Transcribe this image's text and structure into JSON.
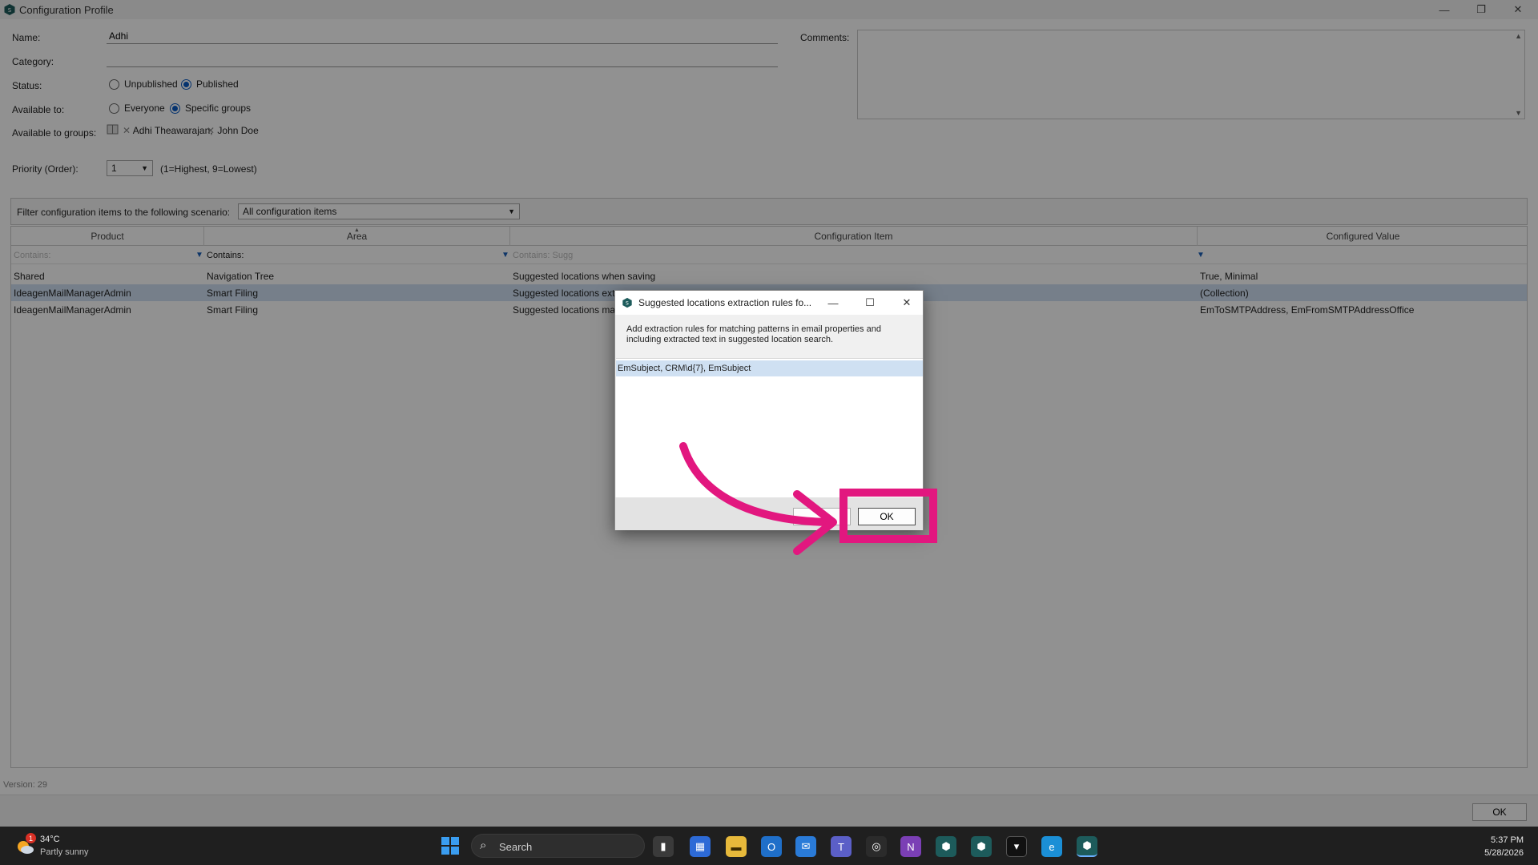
{
  "window": {
    "title": "Configuration Profile",
    "minimize": "—",
    "restore": "❐",
    "close": "✕"
  },
  "form": {
    "name_label": "Name:",
    "name_value": "Adhi",
    "category_label": "Category:",
    "category_value": "",
    "status_label": "Status:",
    "status_options": [
      "Unpublished",
      "Published"
    ],
    "status_selected": "Published",
    "available_label": "Available to:",
    "available_options": [
      "Everyone",
      "Specific groups"
    ],
    "available_selected": "Specific groups",
    "groups_label": "Available to groups:",
    "groups": [
      "Adhi Theawarajan,",
      "John  Doe"
    ],
    "priority_label": "Priority (Order):",
    "priority_value": "1",
    "priority_hint": "(1=Highest, 9=Lowest)",
    "comments_label": "Comments:"
  },
  "filter": {
    "label": "Filter configuration items to the following scenario:",
    "value": "All configuration items"
  },
  "grid": {
    "columns": [
      "Product",
      "Area",
      "Configuration Item",
      "Configured Value"
    ],
    "filter_placeholders": [
      "Contains:",
      "Contains:",
      "Contains: Sugg",
      ""
    ],
    "rows": [
      {
        "product": "Shared",
        "area": "Navigation Tree",
        "item": "Suggested locations when saving",
        "value": "True, Minimal",
        "selected": false
      },
      {
        "product": "IdeagenMailManagerAdmin",
        "area": "Smart Filing",
        "item": "Suggested locations extra",
        "value": "(Collection)",
        "selected": true
      },
      {
        "product": "IdeagenMailManagerAdmin",
        "area": "Smart Filing",
        "item": "Suggested locations mana",
        "value": "EmToSMTPAddress, EmFromSMTPAddressOffice",
        "selected": false
      }
    ]
  },
  "version_text": "Version:  29",
  "main_ok": "OK",
  "dialog": {
    "title": "Suggested locations extraction rules fo...",
    "description": "Add extraction rules for matching patterns in email properties and including extracted text in suggested location search.",
    "items": [
      "EmSubject, CRM\\d{7}, EmSubject"
    ],
    "ok_label": "OK",
    "cancel_label": ""
  },
  "taskbar": {
    "weather_temp": "34°C",
    "weather_desc": "Partly sunny",
    "weather_badge": "1",
    "search_placeholder": "Search",
    "time": "5:37 PM",
    "date": "5/28/2026"
  },
  "colors": {
    "accent": "#0a5bc4",
    "highlight": "#e2177f",
    "selection": "#cfe0f2"
  }
}
